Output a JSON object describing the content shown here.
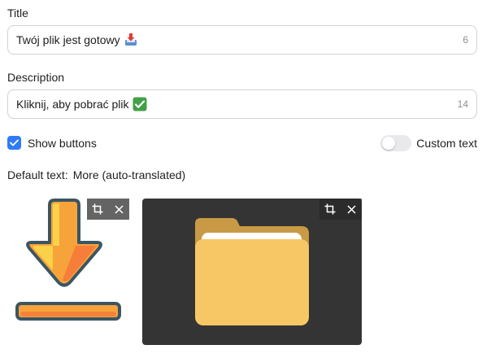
{
  "title_field": {
    "label": "Title",
    "value": "Twój plik jest gotowy",
    "emoji": "inbox-tray-icon",
    "counter": "6"
  },
  "description_field": {
    "label": "Description",
    "value": "Kliknij, aby pobrać plik",
    "emoji": "check-mark-button-icon",
    "counter": "14"
  },
  "show_buttons": {
    "label": "Show buttons",
    "checked": true
  },
  "custom_text": {
    "label": "Custom text",
    "enabled": false
  },
  "default_text": {
    "prefix": "Default text:",
    "value": "More (auto-translated)"
  },
  "images": [
    {
      "name": "download-arrow-image",
      "tools": [
        "crop-icon",
        "close-icon"
      ]
    },
    {
      "name": "folder-image",
      "tools": [
        "crop-icon",
        "close-icon"
      ]
    }
  ],
  "colors": {
    "accent": "#2f7bf5",
    "border": "#d2d2d7",
    "counter": "#8e8e93",
    "dark_card": "#343434"
  }
}
